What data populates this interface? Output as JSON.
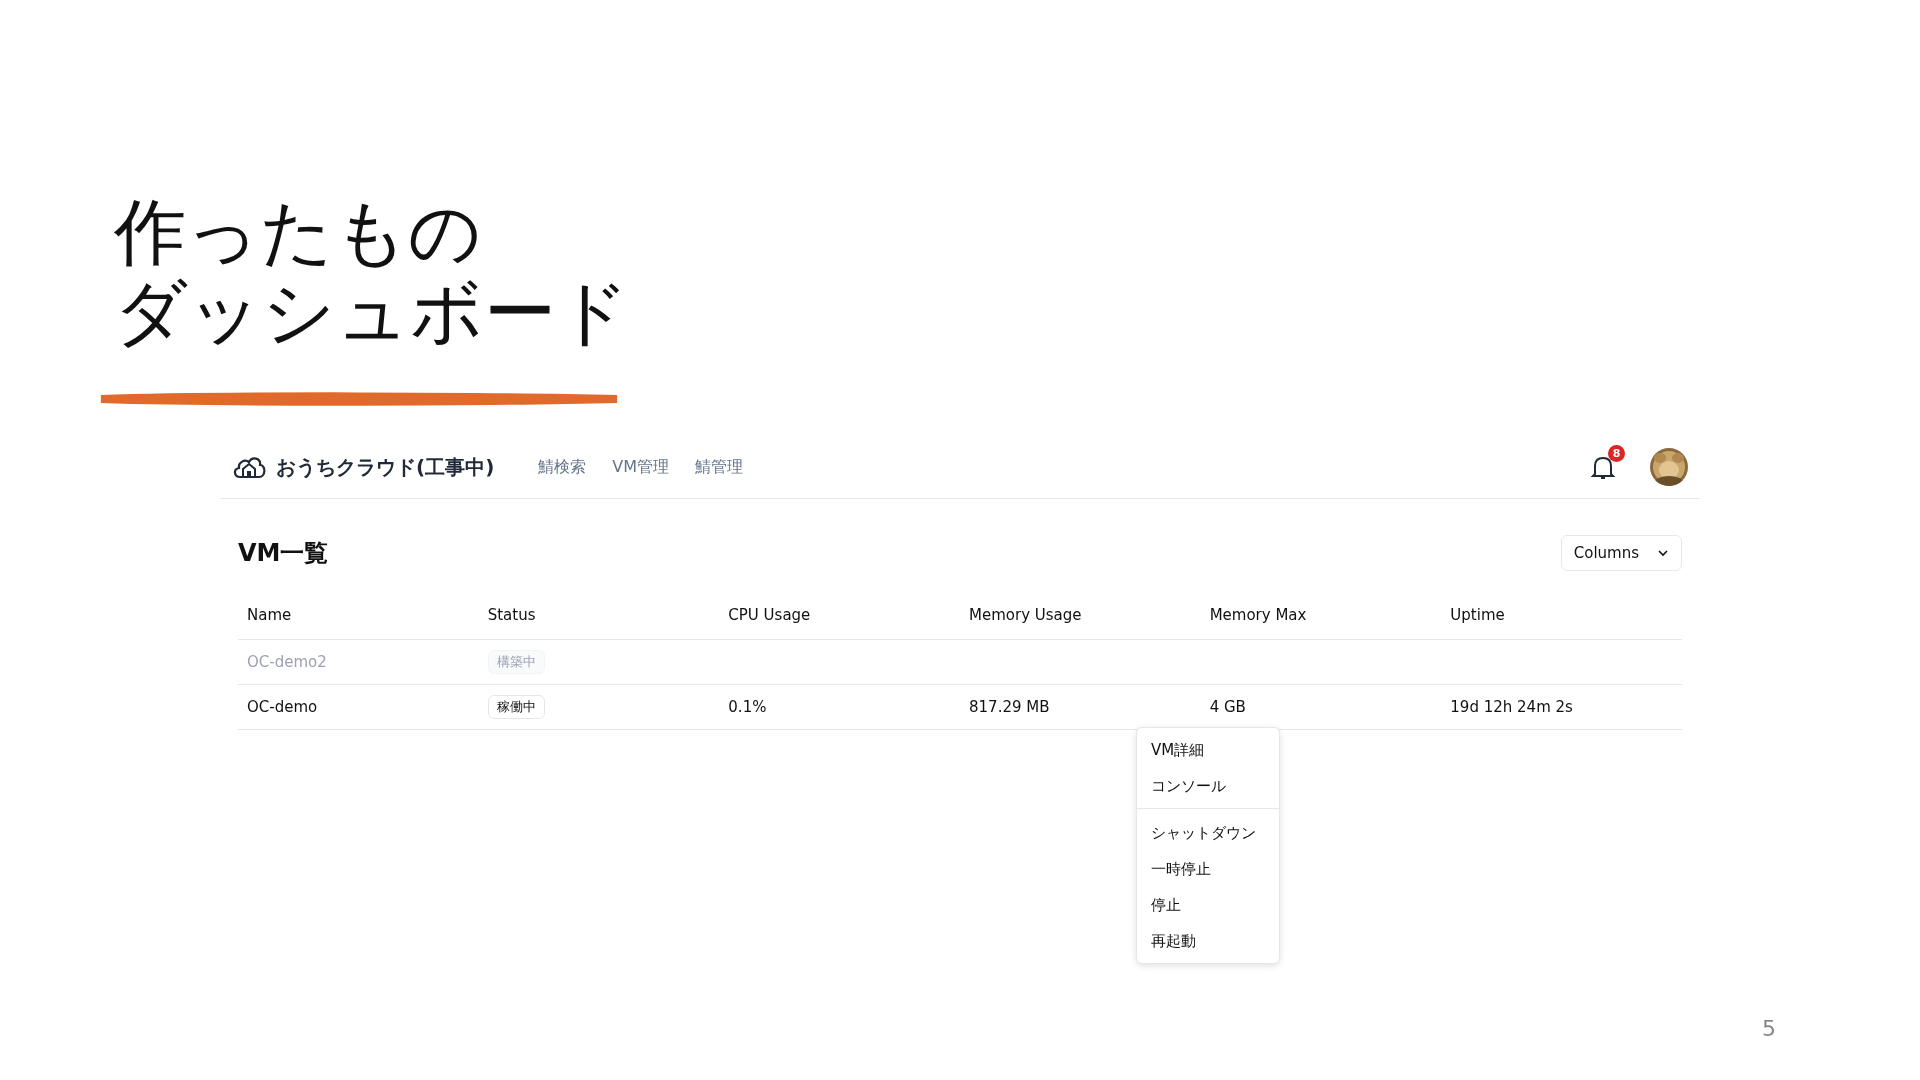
{
  "slide": {
    "title_lines": [
      "作ったもの",
      "ダッシュボード"
    ],
    "page_number": "5"
  },
  "navbar": {
    "brand": "おうちクラウド(工事中)",
    "links": [
      {
        "label": "鯖検索"
      },
      {
        "label": "VM管理"
      },
      {
        "label": "鯖管理"
      }
    ],
    "notification_count": "8"
  },
  "page": {
    "heading": "VM一覧",
    "columns_button": "Columns"
  },
  "table": {
    "columns": [
      "Name",
      "Status",
      "CPU Usage",
      "Memory Usage",
      "Memory Max",
      "Uptime"
    ],
    "rows": [
      {
        "name": "OC-demo2",
        "status": "構築中",
        "disabled": true,
        "cpu": "",
        "memory": "",
        "memory_max": "",
        "uptime": ""
      },
      {
        "name": "OC-demo",
        "status": "稼働中",
        "disabled": false,
        "cpu": "0.1%",
        "memory": "817.29 MB",
        "memory_max": "4 GB",
        "uptime": "19d 12h 24m 2s"
      }
    ]
  },
  "context_menu": {
    "groups": [
      [
        "VM詳細",
        "コンソール"
      ],
      [
        "シャットダウン",
        "一時停止",
        "停止",
        "再起動"
      ]
    ]
  }
}
